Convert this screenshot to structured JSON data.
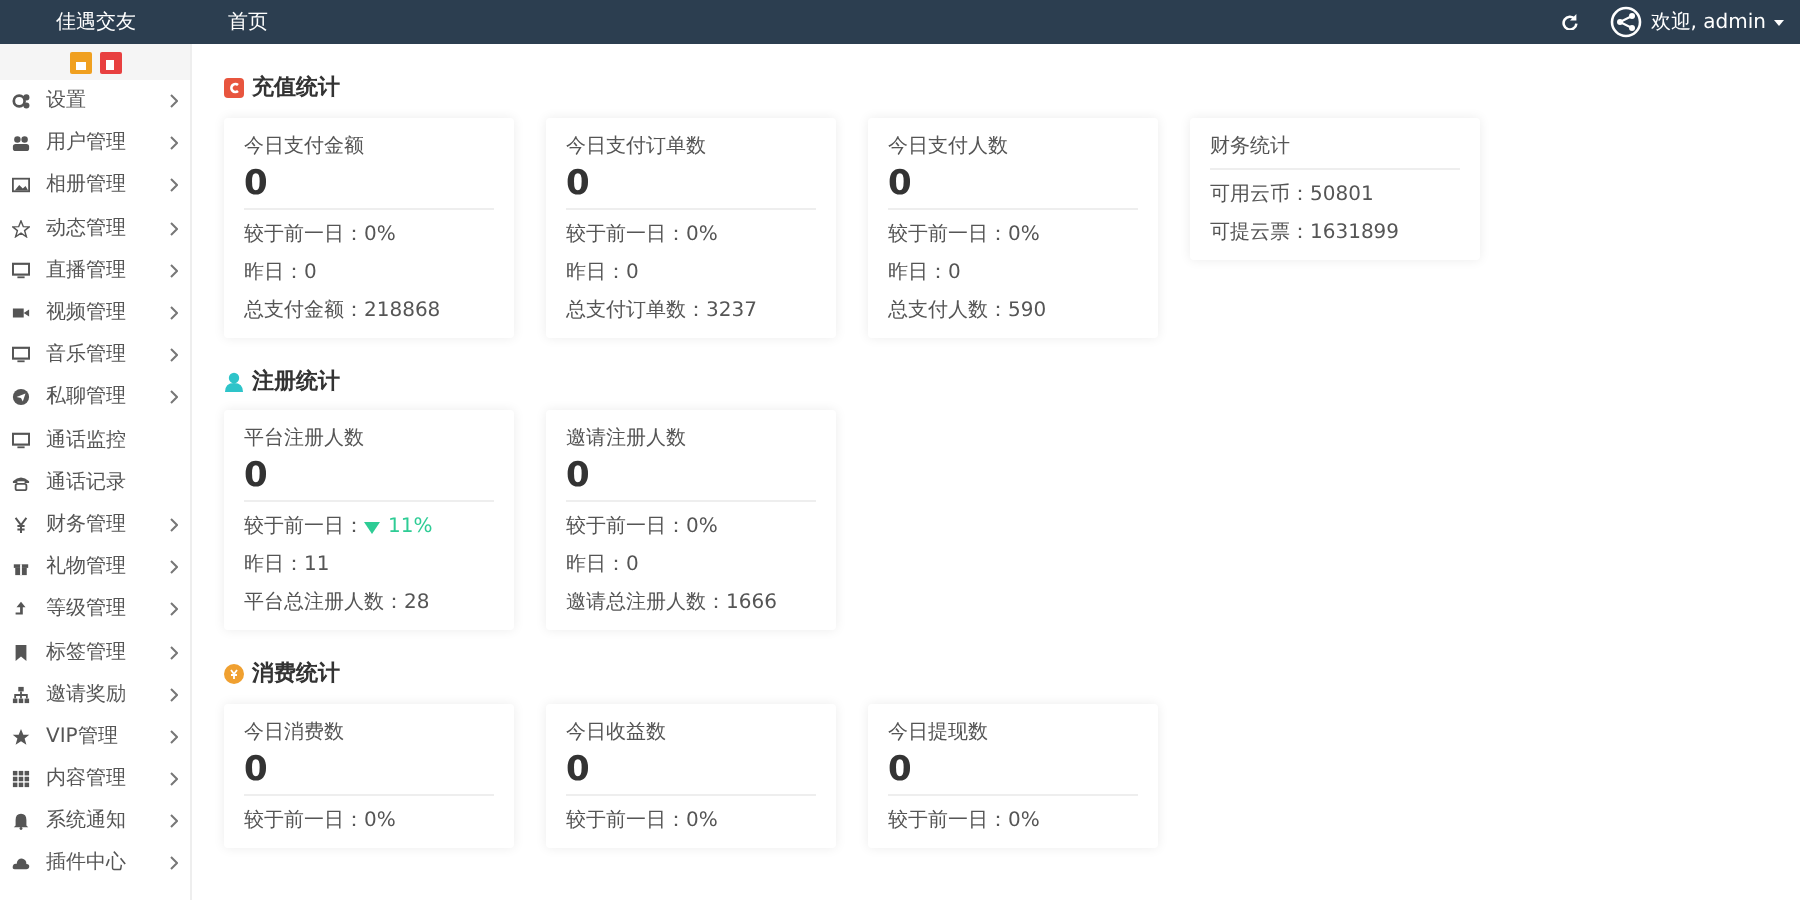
{
  "brand": "佳遇交友",
  "topnav": {
    "home": "首页",
    "user": "欢迎, admin"
  },
  "sidebar": {
    "items": [
      {
        "label": "设置",
        "has_children": true
      },
      {
        "label": "用户管理",
        "has_children": true
      },
      {
        "label": "相册管理",
        "has_children": true
      },
      {
        "label": "动态管理",
        "has_children": true
      },
      {
        "label": "直播管理",
        "has_children": true
      },
      {
        "label": "视频管理",
        "has_children": true
      },
      {
        "label": "音乐管理",
        "has_children": true
      },
      {
        "label": "私聊管理",
        "has_children": true
      },
      {
        "label": "通话监控",
        "has_children": false
      },
      {
        "label": "通话记录",
        "has_children": false
      },
      {
        "label": "财务管理",
        "has_children": true
      },
      {
        "label": "礼物管理",
        "has_children": true
      },
      {
        "label": "等级管理",
        "has_children": true
      },
      {
        "label": "标签管理",
        "has_children": true
      },
      {
        "label": "邀请奖励",
        "has_children": true
      },
      {
        "label": "VIP管理",
        "has_children": true
      },
      {
        "label": "内容管理",
        "has_children": true
      },
      {
        "label": "系统通知",
        "has_children": true
      },
      {
        "label": "插件中心",
        "has_children": true
      }
    ]
  },
  "sections": [
    {
      "title": "充值统计",
      "color": "#e8553e",
      "cards": [
        {
          "kind": "stat",
          "title": "今日支付金额",
          "value": "0",
          "compare_label": "较于前一日：",
          "compare_value": "0%",
          "falling": false,
          "lines": [
            "昨日：0",
            "总支付金额：218868"
          ]
        },
        {
          "kind": "stat",
          "title": "今日支付订单数",
          "value": "0",
          "compare_label": "较于前一日：",
          "compare_value": "0%",
          "falling": false,
          "lines": [
            "昨日：0",
            "总支付订单数：3237"
          ]
        },
        {
          "kind": "stat",
          "title": "今日支付人数",
          "value": "0",
          "compare_label": "较于前一日：",
          "compare_value": "0%",
          "falling": false,
          "lines": [
            "昨日：0",
            "总支付人数：590"
          ]
        },
        {
          "kind": "list",
          "title": "财务统计",
          "lines": [
            "可用云币：50801",
            "可提云票：1631899"
          ]
        }
      ]
    },
    {
      "title": "注册统计",
      "color": "#2ec4c9",
      "cards": [
        {
          "kind": "stat",
          "title": "平台注册人数",
          "value": "0",
          "compare_label": "较于前一日：",
          "compare_value": "11%",
          "falling": true,
          "lines": [
            "昨日：11",
            "平台总注册人数：28"
          ]
        },
        {
          "kind": "stat",
          "title": "邀请注册人数",
          "value": "0",
          "compare_label": "较于前一日：",
          "compare_value": "0%",
          "falling": false,
          "lines": [
            "昨日：0",
            "邀请总注册人数：1666"
          ]
        }
      ]
    },
    {
      "title": "消费统计",
      "color": "#f0a030",
      "cards": [
        {
          "kind": "stat",
          "title": "今日消费数",
          "value": "0",
          "compare_label": "较于前一日：",
          "compare_value": "0%",
          "falling": false
        },
        {
          "kind": "stat",
          "title": "今日收益数",
          "value": "0",
          "compare_label": "较于前一日：",
          "compare_value": "0%",
          "falling": false
        },
        {
          "kind": "stat",
          "title": "今日提现数",
          "value": "0",
          "compare_label": "较于前一日：",
          "compare_value": "0%",
          "falling": false
        }
      ]
    }
  ]
}
